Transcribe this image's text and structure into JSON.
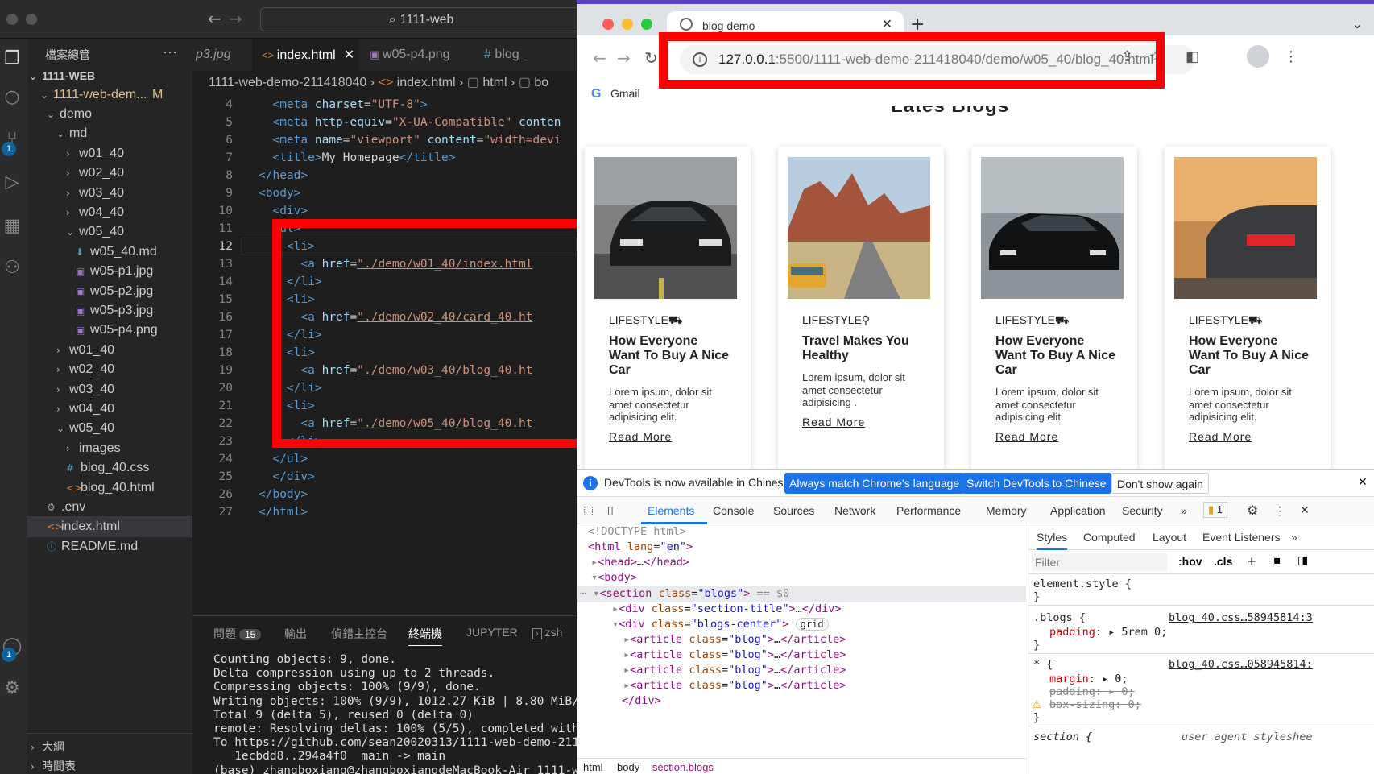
{
  "vscode": {
    "search": "1111-web",
    "explorer_title": "檔案總管",
    "explorer_more": "···",
    "root": "1111-WEB",
    "project": "1111-web-dem...",
    "project_status": "M",
    "tree": [
      {
        "label": "demo",
        "indent": 1,
        "type": "folder-open"
      },
      {
        "label": "md",
        "indent": 2,
        "type": "folder-open"
      },
      {
        "label": "w01_40",
        "indent": 3,
        "type": "folder"
      },
      {
        "label": "w02_40",
        "indent": 3,
        "type": "folder"
      },
      {
        "label": "w03_40",
        "indent": 3,
        "type": "folder"
      },
      {
        "label": "w04_40",
        "indent": 3,
        "type": "folder"
      },
      {
        "label": "w05_40",
        "indent": 3,
        "type": "folder-open"
      },
      {
        "label": "w05_40.md",
        "indent": 4,
        "type": "md"
      },
      {
        "label": "w05-p1.jpg",
        "indent": 4,
        "type": "img"
      },
      {
        "label": "w05-p2.jpg",
        "indent": 4,
        "type": "img"
      },
      {
        "label": "w05-p3.jpg",
        "indent": 4,
        "type": "img"
      },
      {
        "label": "w05-p4.png",
        "indent": 4,
        "type": "img"
      },
      {
        "label": "w01_40",
        "indent": 2,
        "type": "folder"
      },
      {
        "label": "w02_40",
        "indent": 2,
        "type": "folder"
      },
      {
        "label": "w03_40",
        "indent": 2,
        "type": "folder"
      },
      {
        "label": "w04_40",
        "indent": 2,
        "type": "folder"
      },
      {
        "label": "w05_40",
        "indent": 2,
        "type": "folder-open"
      },
      {
        "label": "images",
        "indent": 3,
        "type": "folder"
      },
      {
        "label": "blog_40.css",
        "indent": 3,
        "type": "css"
      },
      {
        "label": "blog_40.html",
        "indent": 3,
        "type": "html"
      },
      {
        "label": ".env",
        "indent": 1,
        "type": "gear"
      },
      {
        "label": "index.html",
        "indent": 1,
        "type": "html",
        "selected": true
      },
      {
        "label": "README.md",
        "indent": 1,
        "type": "info"
      }
    ],
    "outline": "大綱",
    "timeline": "時間表",
    "tabs": [
      {
        "label": "p3.jpg",
        "active": false
      },
      {
        "label": "index.html",
        "active": true
      },
      {
        "label": "w05-p4.png",
        "active": false
      },
      {
        "label": "blog_",
        "active": false
      }
    ],
    "tab_close": "✕",
    "breadcrumb": [
      "1111-web-demo-211418040",
      "index.html",
      "html",
      "bo"
    ],
    "line_numbers": [
      "4",
      "5",
      "6",
      "7",
      "8",
      "9",
      "10",
      "11",
      "12",
      "13",
      "14",
      "15",
      "16",
      "17",
      "18",
      "19",
      "20",
      "21",
      "22",
      "23",
      "24",
      "25",
      "26",
      "27"
    ],
    "current_line": "12",
    "code": [
      "meta_charset",
      "meta_http",
      "meta_viewport",
      "title",
      "head_close",
      "body_open",
      "div_open",
      "ul_open",
      "li",
      "a1",
      "li_c",
      "li",
      "a2",
      "li_c",
      "li",
      "a3",
      "li_c",
      "li",
      "a4",
      "li_c",
      "ul_close",
      "div_close",
      "body_close",
      "html_close"
    ],
    "code_strings": {
      "charset": "\"UTF-8\"",
      "http_equiv": "\"X-UA-Compatible\"",
      "http_content": "conten",
      "viewport": "\"viewport\"",
      "viewport_content": "\"width=devi",
      "title": "My Homepage",
      "href1": "\"./demo/w01_40/index.html",
      "href2": "\"./demo/w02_40/card_40.ht",
      "href3": "\"./demo/w03_40/blog_40.ht",
      "href4": "\"./demo/w05_40/blog_40.ht"
    },
    "panel_tabs": [
      "問題",
      "輸出",
      "偵錯主控台",
      "終端機",
      "JUPYTER"
    ],
    "problems_count": "15",
    "terminal_shell": "zsh",
    "terminal_lines": [
      "Counting objects: 9, done.",
      "Delta compression using up to 2 threads.",
      "Compressing objects: 100% (9/9), done.",
      "Writing objects: 100% (9/9), 1012.27 KiB | 8.80 MiB/s",
      "Total 9 (delta 5), reused 0 (delta 0)",
      "remote: Resolving deltas: 100% (5/5), completed with",
      "To https://github.com/sean20020313/1111-web-demo-2114",
      "   1ecbdd8..294a4f0  main -> main",
      "(base) zhangboxiang@zhangboxiangdeMacBook-Air 1111-we"
    ]
  },
  "chrome": {
    "tab_title": "blog demo",
    "url_host": "127.0.0.1",
    "url_path": ":5500/1111-web-demo-211418040/demo/w05_40/blog_40.html",
    "bookmark": "Gmail",
    "page_heading": "Lates Blogs",
    "cards": [
      {
        "category": "LIFESTYLE",
        "icon": "car-icon",
        "title": "How Everyone Want To Buy A Nice Car",
        "text": "Lorem ipsum, dolor sit amet consectetur adipisicing elit.",
        "link": "Read More",
        "image": "black-mustang"
      },
      {
        "category": "LIFESTYLE",
        "icon": "map-pin-icon",
        "title": "Travel Makes You Healthy",
        "text": "Lorem ipsum, dolor sit amet consectetur adipisicing .",
        "link": "Read More",
        "image": "desert-road-van"
      },
      {
        "category": "LIFESTYLE",
        "icon": "car-icon",
        "title": "How Everyone Want To Buy A Nice Car",
        "text": "Lorem ipsum, dolor sit amet consectetur adipisicing elit.",
        "link": "Read More",
        "image": "black-porsche"
      },
      {
        "category": "LIFESTYLE",
        "icon": "car-icon",
        "title": "How Everyone Want To Buy A Nice Car",
        "text": "Lorem ipsum, dolor sit amet consectetur adipisicing elit.",
        "link": "Read More",
        "image": "red-taillights-car"
      }
    ],
    "devtools": {
      "info_message": "DevTools is now available in Chinese!",
      "btn_match": "Always match Chrome's language",
      "btn_switch": "Switch DevTools to Chinese",
      "btn_dismiss": "Don't show again",
      "tabs": [
        "Elements",
        "Console",
        "Sources",
        "Network",
        "Performance",
        "Memory",
        "Application",
        "Security"
      ],
      "issues_count": "1",
      "dom": {
        "doctype": "<!DOCTYPE html>",
        "html_lang": "\"en\"",
        "section_class": "\"blogs\"",
        "eq": "== $0",
        "div1_class": "\"section-title\"",
        "div2_class": "\"blogs-center\"",
        "grid": "grid",
        "article_class": "\"blog\""
      },
      "crumbs": [
        "html",
        "body",
        "section.blogs"
      ],
      "style_tabs": [
        "Styles",
        "Computed",
        "Layout",
        "Event Listeners"
      ],
      "filter_placeholder": "Filter",
      "hov": ":hov",
      "cls": ".cls",
      "rules": {
        "element_style": "element.style {",
        "blogs_sel": ".blogs {",
        "blogs_file": "blog_40.css…58945814:3",
        "padding_prop": "padding",
        "padding_val": "5rem 0;",
        "star_sel": "* {",
        "star_file": "blog_40.css…058945814:",
        "margin_prop": "margin",
        "margin_val": "0;",
        "padding2": "padding: ▸ 0;",
        "boxsizing": "box-sizing: 0;",
        "section_sel": "section {",
        "ua": "user agent styleshee"
      }
    }
  },
  "colors": {
    "highlight": "#ff0000",
    "accent": "#1a73e8"
  }
}
